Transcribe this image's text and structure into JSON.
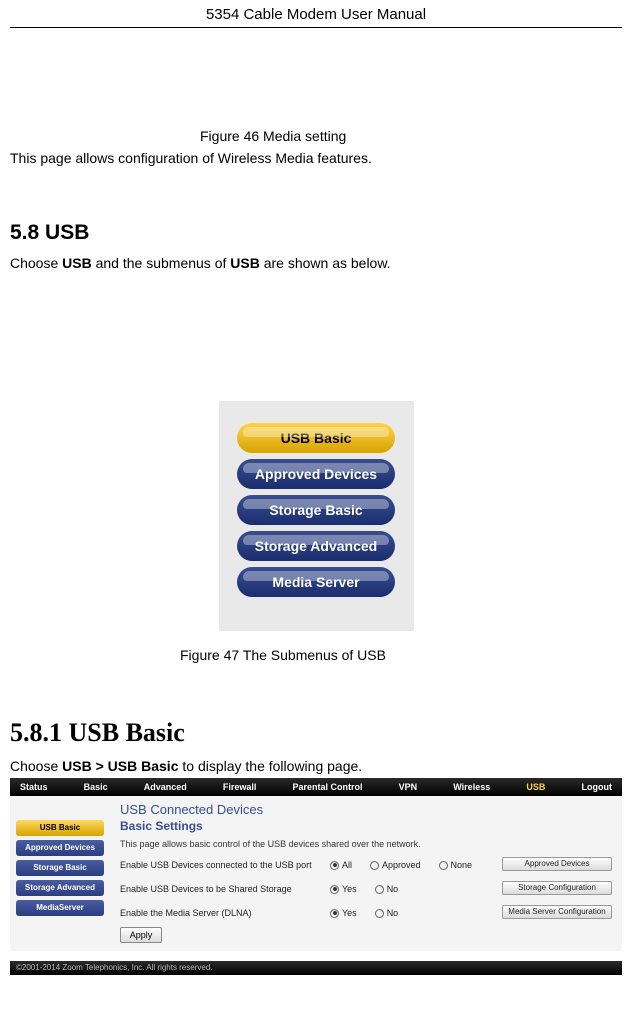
{
  "header": {
    "title": "5354 Cable Modem User Manual"
  },
  "figure46": {
    "caption": "Figure 46 Media setting"
  },
  "intro_text": "This page allows configuration of Wireless Media features.",
  "section58": {
    "heading": "5.8    USB",
    "line_prefix": "Choose ",
    "bold1": "USB",
    "mid": " and the submenus of ",
    "bold2": "USB",
    "suffix": " are shown as below."
  },
  "submenu": {
    "items": [
      "USB Basic",
      "Approved Devices",
      "Storage Basic",
      "Storage Advanced",
      "Media Server"
    ],
    "active_index": 0
  },
  "figure47": {
    "caption": "Figure 47 The Submenus of USB"
  },
  "section581": {
    "heading": "5.8.1  USB Basic",
    "line_prefix": "Choose ",
    "bold1": "USB > USB Basic",
    "suffix": " to display the following page."
  },
  "screenshot": {
    "nav": [
      "Status",
      "Basic",
      "Advanced",
      "Firewall",
      "Parental Control",
      "VPN",
      "Wireless",
      "USB",
      "Logout"
    ],
    "nav_active": "USB",
    "sidebar": [
      "USB Basic",
      "Approved Devices",
      "Storage Basic",
      "Storage Advanced",
      "MediaServer"
    ],
    "sidebar_active": 0,
    "panel": {
      "title": "USB Connected Devices",
      "subtitle": "Basic Settings",
      "desc": "This page allows basic control of the USB devices shared over the network.",
      "rows": [
        {
          "label": "Enable USB Devices connected to the USB port",
          "options": [
            "All",
            "Approved",
            "None"
          ],
          "checked": 0,
          "right_btn": "Approved Devices"
        },
        {
          "label": "Enable USB Devices to be Shared Storage",
          "options": [
            "Yes",
            "No"
          ],
          "checked": 0,
          "right_btn": "Storage Configuration"
        },
        {
          "label": "Enable the Media Server (DLNA)",
          "options": [
            "Yes",
            "No"
          ],
          "checked": 0,
          "right_btn": "Media Server Configuration"
        }
      ],
      "apply": "Apply"
    },
    "footer": "©2001-2014 Zoom Telephonics, Inc. All rights reserved."
  }
}
